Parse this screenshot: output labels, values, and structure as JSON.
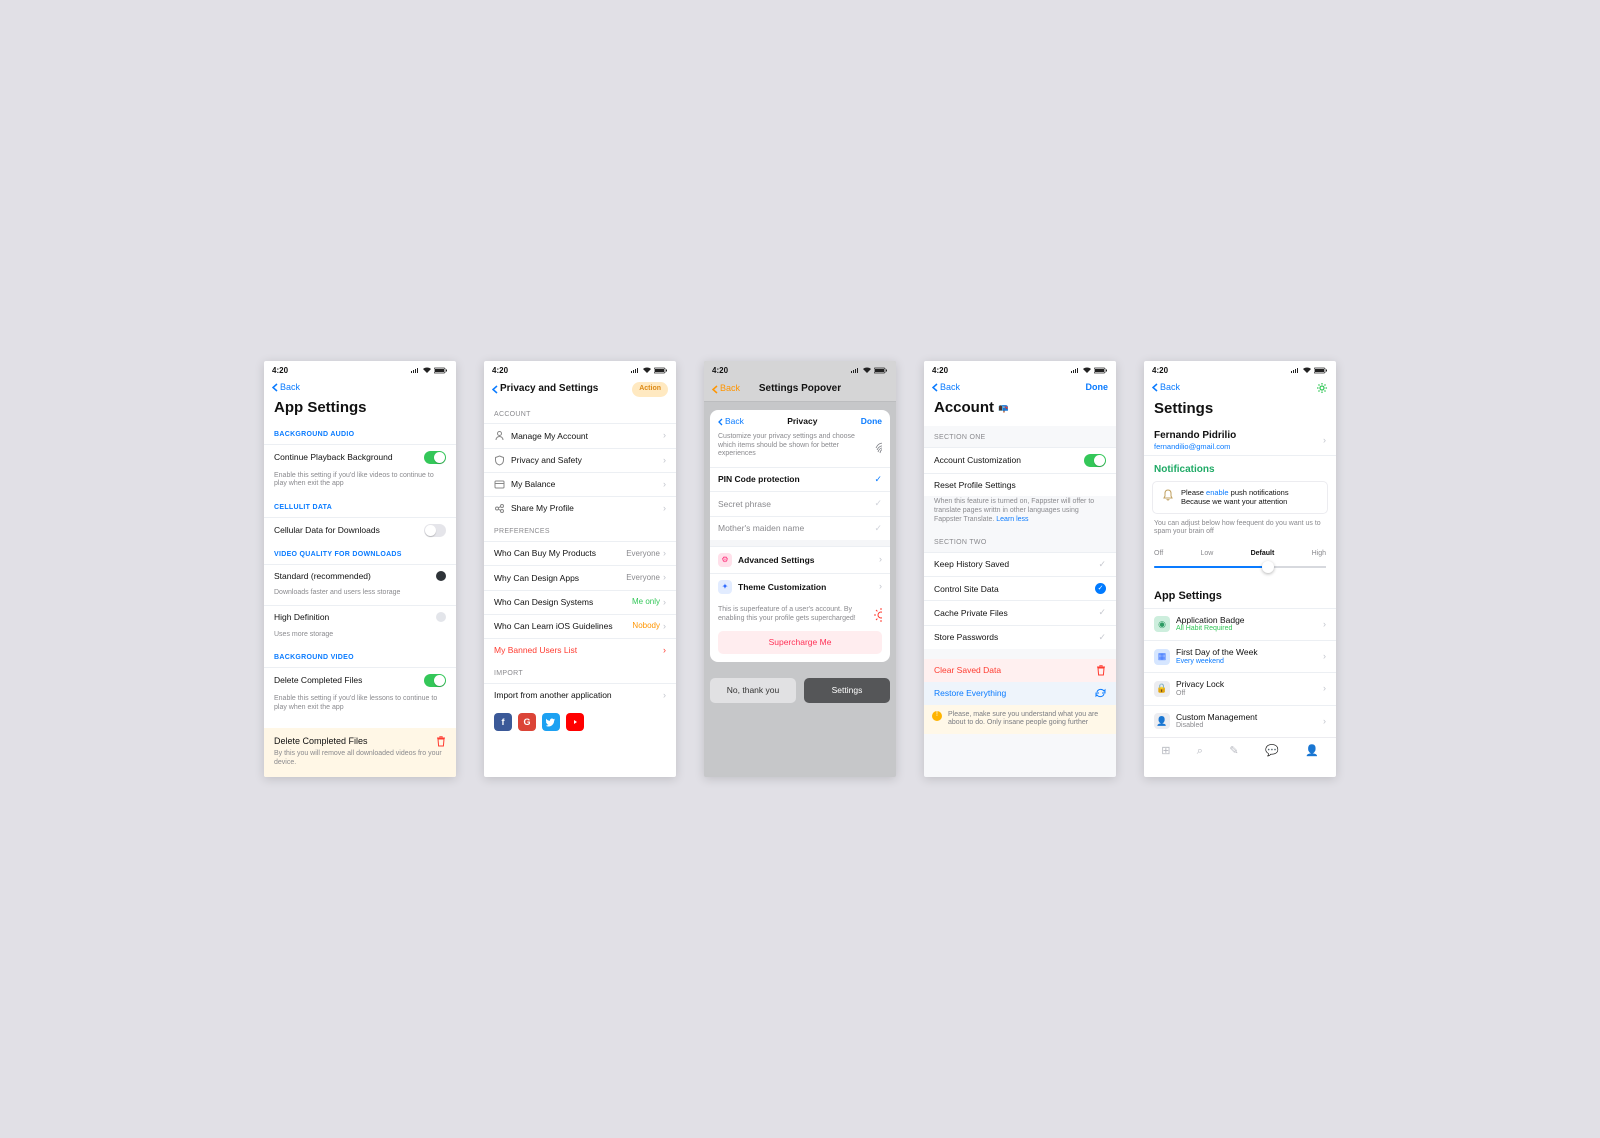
{
  "status": {
    "time": "4:20"
  },
  "s1": {
    "back": "Back",
    "title": "App Settings",
    "sec1": "BACKGROUND AUDIO",
    "row1": "Continue Playback Background",
    "row1_desc": "Enable this setting if you'd like videos to continue to play when exit the app",
    "sec2": "CELLULIT DATA",
    "row2": "Cellular Data for Downloads",
    "sec3": "VIDEO QUALITY FOR DOWNLOADS",
    "q1": "Standard (recommended)",
    "q1_desc": "Downloads faster and users less storage",
    "q2": "High Definition",
    "q2_desc": "Uses more storage",
    "sec4": "BACKGROUND VIDEO",
    "row4": "Delete Completed Files",
    "row4_desc": "Enable this setting if you'd like lessons to continue to play when exit the app",
    "warn_t": "Delete Completed Files",
    "warn_d": "By this you will remove all downloaded videos fro your device."
  },
  "s2": {
    "back": "",
    "title": "Privacy and Settings",
    "action": "Action",
    "sec1": "ACCOUNT",
    "r1": "Manage My Account",
    "r2": "Privacy and Safety",
    "r3": "My Balance",
    "r4": "Share My Profile",
    "sec2": "PREFERENCES",
    "p1": "Who Can Buy My Products",
    "v1": "Everyone",
    "p2": "Why Can Design Apps",
    "v2": "Everyone",
    "p3": "Who Can Design Systems",
    "v3": "Me only",
    "p4": "Who Can Learn iOS Guidelines",
    "v4": "Nobody",
    "p5": "My Banned Users List",
    "sec3": "IMPORT",
    "imp": "Import from another application"
  },
  "s3": {
    "back": "Back",
    "title": "Settings Popover",
    "sheet_back": "Back",
    "sheet_title": "Privacy",
    "sheet_done": "Done",
    "sheet_desc": "Customize your privacy settings and choose which items should be shown for better experiences",
    "pin": "PIN Code protection",
    "secret": "Secret phrase",
    "maiden": "Mother's maiden name",
    "adv": "Advanced Settings",
    "theme": "Theme Customization",
    "foot": "This is superfeature of a user's account. By enabling this your profile gets supercharged!",
    "super": "Supercharge Me",
    "btn_no": "No, thank you",
    "btn_set": "Settings"
  },
  "s4": {
    "back": "Back",
    "done": "Done",
    "title": "Account",
    "sec1": "SECTION ONE",
    "r1": "Account Customization",
    "r2": "Reset Profile Settings",
    "note1a": "When this feature is turned on, Fappster will offer to translate pages writtn in other languages using Fappster Translate. ",
    "note1b": "Learn less",
    "sec2": "SECTION TWO",
    "k1": "Keep History Saved",
    "k2": "Control Site Data",
    "k3": "Cache Private Files",
    "k4": "Store Passwords",
    "clear": "Clear Saved Data",
    "restore": "Restore Everything",
    "warn": "Please, make sure you understand what you are about to do. Only insane people going further"
  },
  "s5": {
    "back": "Back",
    "title": "Settings",
    "name": "Fernando Pidrilio",
    "email": "fernandilio@gmail.com",
    "notif_hdr": "Notifications",
    "notif_a": "Please ",
    "notif_b": "enable",
    "notif_c": " push notifications Because we want your attention",
    "slider_desc": "You can adjust below how feequent do you want us to spam your brain off",
    "lv_off": "Off",
    "lv_low": "Low",
    "lv_def": "Default",
    "lv_high": "High",
    "app_hdr": "App Settings",
    "a1": "Application Badge",
    "a1s": "All Habit Required",
    "a2": "First Day of the Week",
    "a2s": "Every weekend",
    "a3": "Privacy Lock",
    "a3s": "Off",
    "a4": "Custom Management",
    "a4s": "Disabled"
  }
}
